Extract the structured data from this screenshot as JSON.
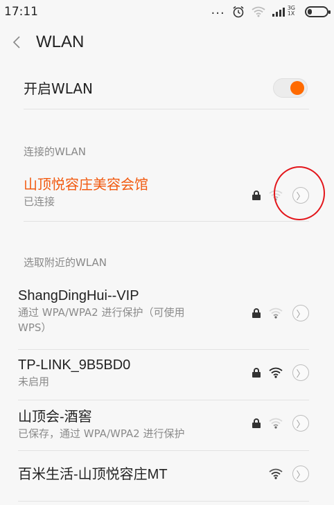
{
  "status_bar": {
    "time": "17:11",
    "dots": "...",
    "network_type_top": "3G",
    "network_type_bottom": "1X"
  },
  "header": {
    "back_icon": "chevron-left-icon",
    "title": "WLAN"
  },
  "toggle_row": {
    "label": "开启WLAN",
    "enabled": true,
    "accent_color": "#ff6a00"
  },
  "connected_section": {
    "label": "连接的WLAN",
    "network": {
      "name": "山顶悦容庄美容会馆",
      "status": "已连接",
      "name_color": "#f25a10",
      "secured": true,
      "signal": "weak"
    }
  },
  "nearby_section": {
    "label": "选取附近的WLAN",
    "networks": [
      {
        "name": "ShangDingHui--VIP",
        "status": "通过 WPA/WPA2 进行保护（可使用",
        "status_line2": "WPS）",
        "secured": true,
        "signal": "weak"
      },
      {
        "name": "TP-LINK_9B5BD0",
        "status": "未启用",
        "secured": true,
        "signal": "strong"
      },
      {
        "name": "山顶会-酒窖",
        "status": "已保存，通过 WPA/WPA2 进行保护",
        "secured": true,
        "signal": "weak"
      },
      {
        "name": "百米生活-山顶悦容庄MT",
        "status": "",
        "secured": false,
        "signal": "medium"
      }
    ]
  },
  "detail_glyph": "〉"
}
